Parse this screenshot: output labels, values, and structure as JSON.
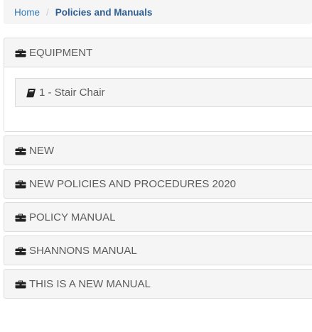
{
  "breadcrumb": {
    "home": "Home",
    "separator": "/",
    "current": "Policies and Manuals"
  },
  "categories": [
    {
      "label": "EQUIPMENT",
      "icon": "briefcase-icon",
      "expanded": true,
      "items": [
        {
          "label": "1 - Stair Chair",
          "icon": "book-icon"
        }
      ]
    },
    {
      "label": "NEW",
      "icon": "briefcase-icon"
    },
    {
      "label": "NEW POLICIES AND PROCEDURES 2020",
      "icon": "briefcase-icon"
    },
    {
      "label": "POLICY MANUAL",
      "icon": "briefcase-icon"
    },
    {
      "label": "SHANNONS MANUAL",
      "icon": "briefcase-icon"
    },
    {
      "label": "THIS IS A NEW MANUAL",
      "icon": "briefcase-icon"
    }
  ],
  "colors": {
    "link": "#337ab7",
    "active": "#2f5f92",
    "panel_bg": "#f5f5f5",
    "border": "#dddddd",
    "text": "#5d5d5d"
  }
}
